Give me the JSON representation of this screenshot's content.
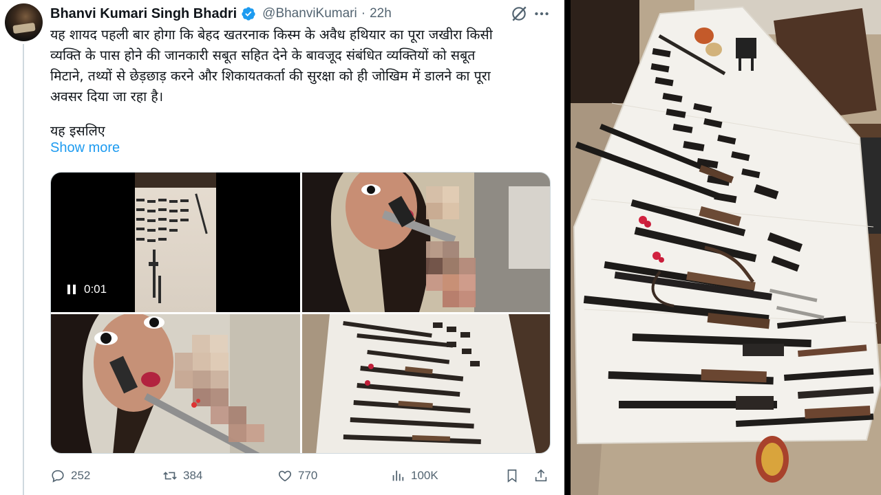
{
  "tweet": {
    "author_name": "Bhanvi Kumari Singh Bhadri",
    "handle": "@BhanviKumari",
    "separator": "·",
    "time": "22h",
    "body": "यह शायद पहली बार होगा कि बेहद खतरनाक किस्म के अवैध हथियार का पूरा जखीरा किसी\nव्यक्ति के पास होने की जानकारी सबूत सहित देने के बावजूद संबंधित व्यक्तियों को सबूत\nमिटाने, तथ्यों से छेड़छाड़ करने और शिकायतकर्ता की सुरक्षा को ही जोखिम में डालने का पूरा\nअवसर दिया जा रहा है।",
    "body_continued": "यह इसलिए",
    "show_more": "Show more",
    "video_time": "0:01",
    "stats": {
      "replies": "252",
      "reposts": "384",
      "likes": "770",
      "views": "100K"
    }
  },
  "colors": {
    "text": "#0f1419",
    "secondary": "#536471",
    "link": "#1d9bf0",
    "verified": "#1d9bf0",
    "border": "#cfd9de"
  },
  "icons": [
    "verified-badge-icon",
    "grok-icon",
    "more-icon",
    "pause-icon",
    "reply-icon",
    "repost-icon",
    "like-icon",
    "views-icon",
    "bookmark-icon",
    "share-icon"
  ]
}
